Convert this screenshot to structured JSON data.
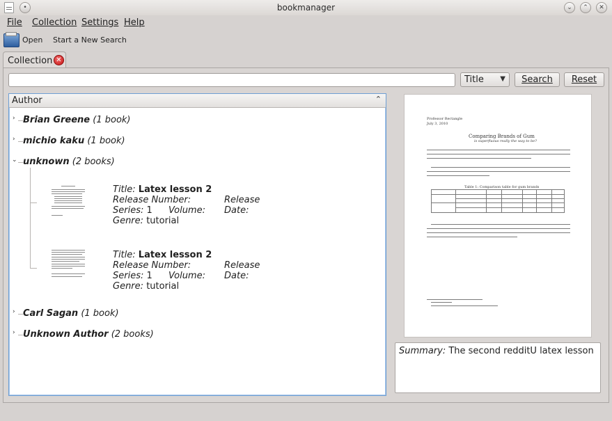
{
  "window": {
    "title": "bookmanager"
  },
  "menubar": {
    "items": [
      "File",
      "Collection",
      "Settings",
      "Help"
    ]
  },
  "toolbar": {
    "open_label": "Open",
    "new_search_label": "Start a New Search"
  },
  "tabs": [
    {
      "label": "Collection"
    }
  ],
  "search": {
    "query": "",
    "field": "Title",
    "search_label": "Search",
    "reset_label": "Reset"
  },
  "tree": {
    "header": "Author",
    "authors": [
      {
        "name": "Brian Greene",
        "count": "(1 book)"
      },
      {
        "name": "michio kaku",
        "count": "(1 book)"
      },
      {
        "name": "unknown",
        "count": "(2 books)"
      },
      {
        "name": "Carl Sagan",
        "count": "(1 book)"
      },
      {
        "name": "Unknown Author",
        "count": "(2 books)"
      }
    ],
    "books": [
      {
        "title": "Latex lesson 2",
        "release_number": "",
        "release_date": "",
        "series": "1",
        "volume": "",
        "genre": "tutorial"
      },
      {
        "title": "Latex lesson 2",
        "release_number": "",
        "release_date": "",
        "series": "1",
        "volume": "",
        "genre": "tutorial"
      }
    ],
    "labels": {
      "title": "Title:",
      "release_number": "Release Number:",
      "release_date": "Release Date:",
      "series": "Series:",
      "volume": "Volume:",
      "genre": "Genre:"
    }
  },
  "preview": {
    "author": "Professor Rectangle",
    "date": "July 3, 2010",
    "heading": "Comparing Brands of Gum",
    "subheading": "is superfluous really the way to be?",
    "table_caption": "Table 1: Comparison table for gum brands"
  },
  "summary": {
    "label": "Summary:",
    "text": "The second redditU latex lesson"
  },
  "colors": {
    "accent": "#6e9fd4",
    "close": "#c81414"
  }
}
